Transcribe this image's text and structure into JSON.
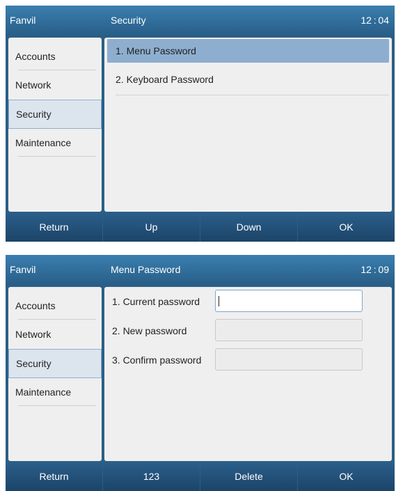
{
  "screens": [
    {
      "brand": "Fanvil",
      "title": "Security",
      "clock": "12 : 04",
      "sidebar": [
        "Accounts",
        "Network",
        "Security",
        "Maintenance"
      ],
      "menu": [
        "1. Menu Password",
        "2. Keyboard Password"
      ],
      "softkeys": [
        "Return",
        "Up",
        "Down",
        "OK"
      ]
    },
    {
      "brand": "Fanvil",
      "title": "Menu Password",
      "clock": "12 : 09",
      "sidebar": [
        "Accounts",
        "Network",
        "Security",
        "Maintenance"
      ],
      "form": [
        {
          "label": "1. Current password",
          "value": ""
        },
        {
          "label": "2. New password",
          "value": ""
        },
        {
          "label": "3. Confirm password",
          "value": ""
        }
      ],
      "softkeys": [
        "Return",
        "123",
        "Delete",
        "OK"
      ]
    }
  ]
}
